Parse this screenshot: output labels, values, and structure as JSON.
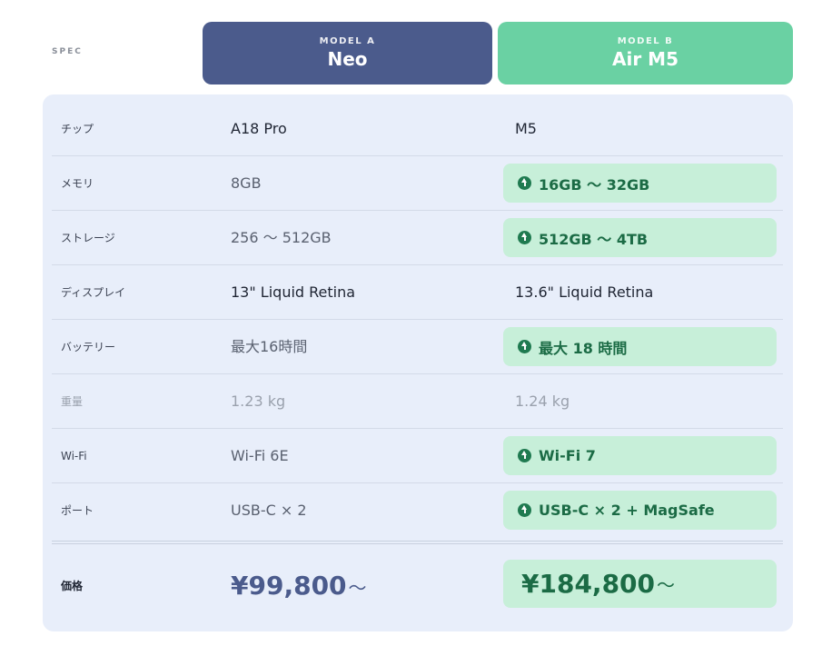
{
  "header": {
    "spec_label": "SPEC",
    "model_a": {
      "tag": "MODEL A",
      "name": "Neo",
      "color": "#4b5b8c"
    },
    "model_b": {
      "tag": "MODEL B",
      "name": "Air M5",
      "color": "#6ad1a3"
    }
  },
  "rows": [
    {
      "label": "チップ",
      "a": "A18 Pro",
      "b": "M5",
      "b_upgrade": false
    },
    {
      "label": "メモリ",
      "a": "8GB",
      "b": "16GB 〜 32GB",
      "b_upgrade": true
    },
    {
      "label": "ストレージ",
      "a": "256 〜 512GB",
      "b": "512GB 〜 4TB",
      "b_upgrade": true
    },
    {
      "label": "ディスプレイ",
      "a": "13\" Liquid Retina",
      "b": "13.6\" Liquid Retina",
      "b_upgrade": false
    },
    {
      "label": "バッテリー",
      "a": "最大16時間",
      "b": "最大 18 時間",
      "b_upgrade": true
    },
    {
      "label": "重量",
      "a": "1.23 kg",
      "b": "1.24 kg",
      "b_upgrade": false
    },
    {
      "label": "Wi-Fi",
      "a": "Wi-Fi 6E",
      "b": "Wi-Fi 7",
      "b_upgrade": true
    },
    {
      "label": "ポート",
      "a": "USB-C × 2",
      "b": "USB-C × 2 + MagSafe",
      "b_upgrade": true
    }
  ],
  "price": {
    "label": "価格",
    "a": "¥99,800",
    "b": "¥184,800",
    "suffix": "〜"
  },
  "icons": {
    "upgrade": "arrow-up-circle-icon"
  },
  "colors": {
    "highlight_bg": "#c7efd9",
    "highlight_text": "#1b6b45",
    "card_bg": "#e8eefa"
  }
}
